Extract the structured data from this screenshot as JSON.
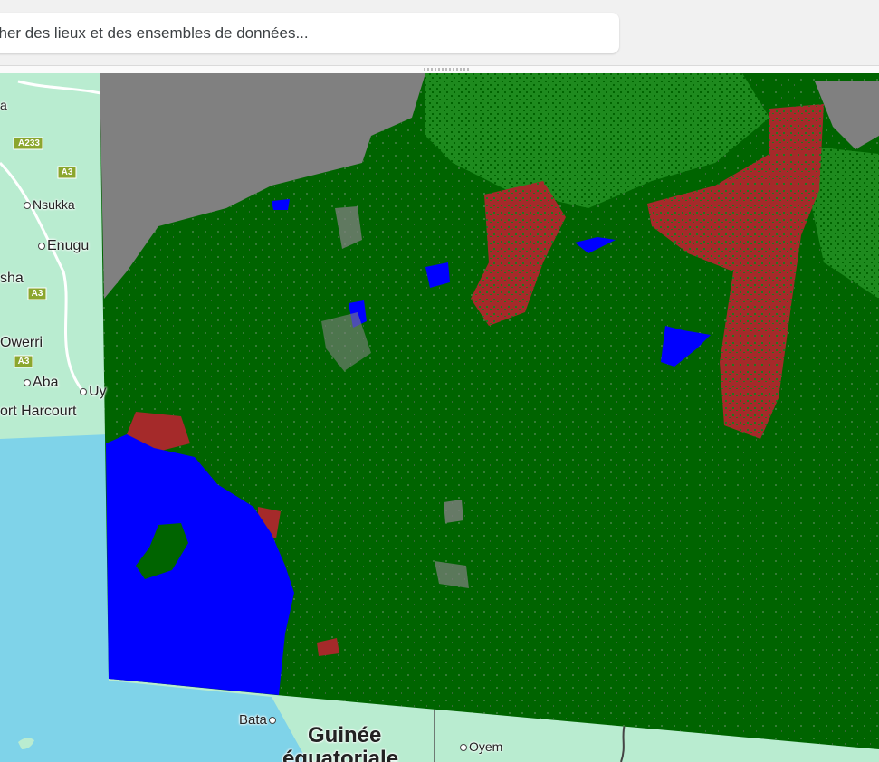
{
  "search": {
    "placeholder": "cher des lieux et des ensembles de données..."
  },
  "map": {
    "cities": {
      "nsukka": "Nsukka",
      "enugu": "Enugu",
      "sha": "sha",
      "owerri": "Owerri",
      "aba": "Aba",
      "uy": "Uy",
      "port_harcourt": "ort Harcourt",
      "bata": "Bata",
      "oyem": "Oyem",
      "a": "a"
    },
    "country": {
      "line1": "Guinée",
      "line2": "équatoriale"
    },
    "roads": {
      "a233": "A233",
      "a3_1": "A3",
      "a3_2": "A3",
      "a3_3": "A3"
    },
    "colors": {
      "forest": "#006400",
      "savanna": "#228b22",
      "cropland": "#a52a2a",
      "water": "#0000ff",
      "barren": "#808080",
      "ocean": "#7fd3e9",
      "land": "#b9ecd0"
    }
  }
}
